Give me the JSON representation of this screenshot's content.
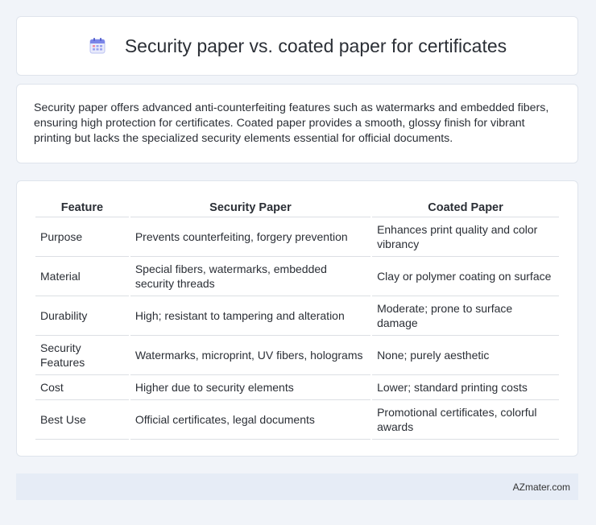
{
  "header": {
    "title": "Security paper vs. coated paper for certificates",
    "icon": "calendar-icon"
  },
  "summary": {
    "text": "Security paper offers advanced anti-counterfeiting features such as watermarks and embedded fibers, ensuring high protection for certificates. Coated paper provides a smooth, glossy finish for vibrant printing but lacks the specialized security elements essential for official documents."
  },
  "table": {
    "headers": [
      "Feature",
      "Security Paper",
      "Coated Paper"
    ],
    "rows": [
      [
        "Purpose",
        "Prevents counterfeiting, forgery prevention",
        "Enhances print quality and color vibrancy"
      ],
      [
        "Material",
        "Special fibers, watermarks, embedded security threads",
        "Clay or polymer coating on surface"
      ],
      [
        "Durability",
        "High; resistant to tampering and alteration",
        "Moderate; prone to surface damage"
      ],
      [
        "Security Features",
        "Watermarks, microprint, UV fibers, holograms",
        "None; purely aesthetic"
      ],
      [
        "Cost",
        "Higher due to security elements",
        "Lower; standard printing costs"
      ],
      [
        "Best Use",
        "Official certificates, legal documents",
        "Promotional certificates, colorful awards"
      ]
    ]
  },
  "footer": {
    "text": "AZmater.com"
  },
  "colors": {
    "background": "#f1f4f9",
    "card": "#ffffff",
    "footer": "#e6ecf6",
    "icon_accent": "#7b86e8"
  }
}
